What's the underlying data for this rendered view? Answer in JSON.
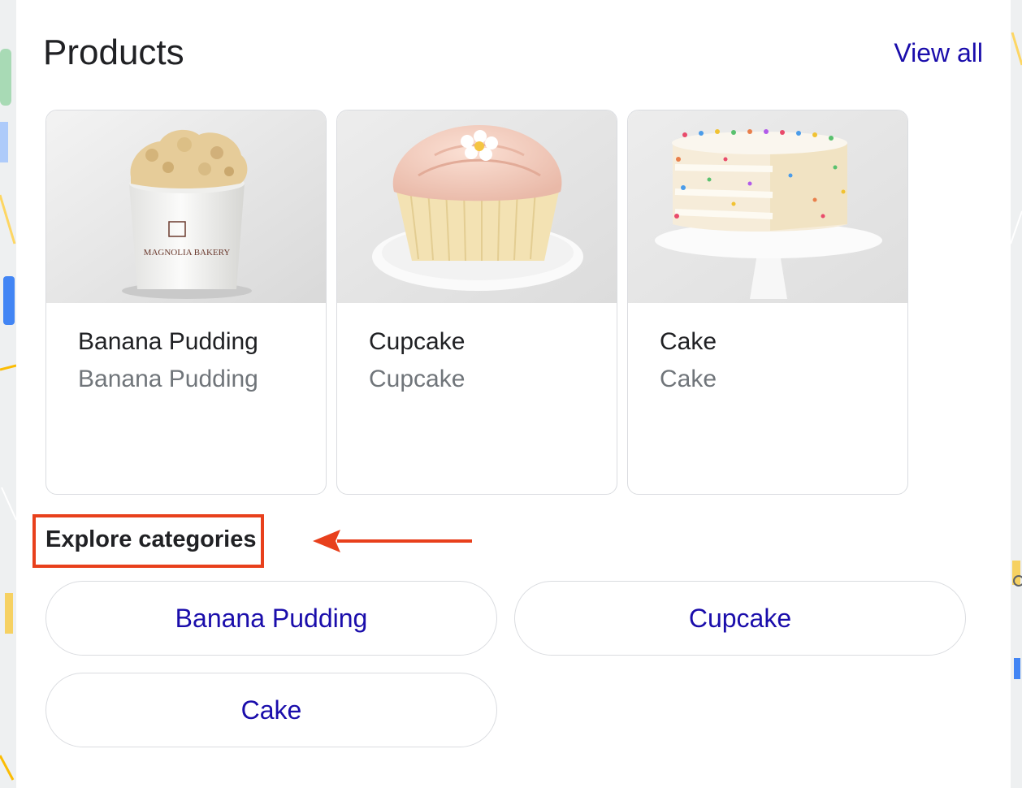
{
  "panel": {
    "title": "Products",
    "view_all_label": "View all"
  },
  "products": [
    {
      "name": "Banana Pudding",
      "subtitle": "Banana Pudding",
      "image_icon": "banana-pudding-image",
      "jar_label": "MAGNOLIA BAKERY"
    },
    {
      "name": "Cupcake",
      "subtitle": "Cupcake",
      "image_icon": "cupcake-image"
    },
    {
      "name": "Cake",
      "subtitle": "Cake",
      "image_icon": "cake-image"
    }
  ],
  "explore": {
    "heading": "Explore categories",
    "categories": [
      "Banana Pudding",
      "Cupcake",
      "Cake"
    ]
  },
  "colors": {
    "link": "#1a0dab",
    "highlight": "#e8401c",
    "subtext": "#70757a"
  }
}
